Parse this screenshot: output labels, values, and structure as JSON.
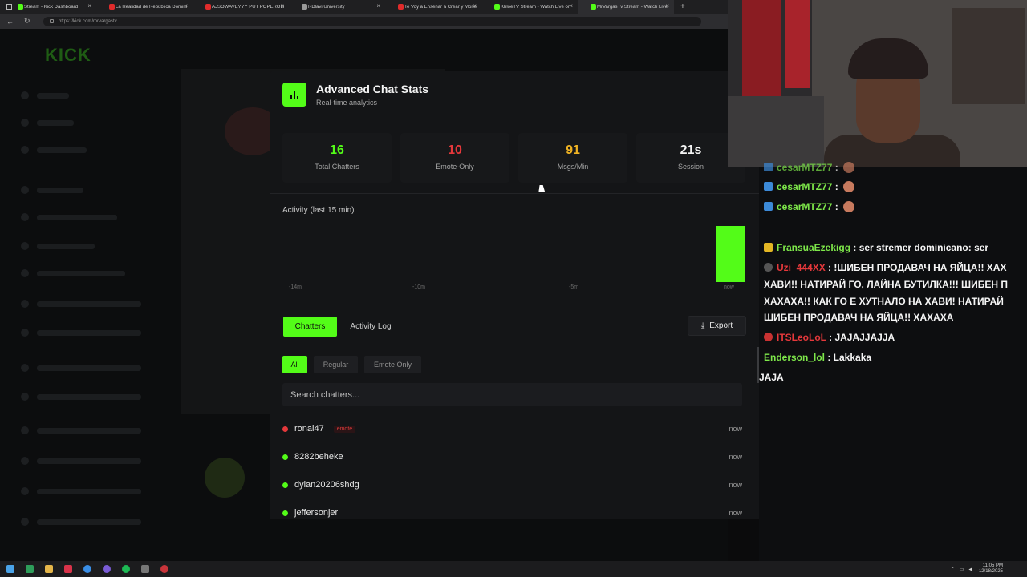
{
  "browser": {
    "tabs": [
      {
        "label": "Stream - Kick Dashboard",
        "color": "#53fc18"
      },
      {
        "label": "La Realidad de República Domini",
        "color": "#e02b2b"
      },
      {
        "label": "AJSOWAVEYYY PUT POPEROLIN",
        "color": "#e02b2b"
      },
      {
        "label": "RDlavi University",
        "color": "#9a9a9a"
      },
      {
        "label": "Te Voy a Enseñar a Crear y Monet",
        "color": "#e02b2b"
      },
      {
        "label": "KhloeTV Stream - Watch Live on",
        "color": "#53fc18"
      },
      {
        "label": "MrVargasTv Stream - Watch Live",
        "color": "#53fc18"
      }
    ],
    "url": "https://kick.com/mrvargastv",
    "new_tab": "+"
  },
  "background_page": {
    "logo": "KICK"
  },
  "modal": {
    "title": "Advanced Chat Stats",
    "subtitle": "Real-time analytics",
    "stats": [
      {
        "value": "16",
        "label": "Total Chatters",
        "color": "#53fc18"
      },
      {
        "value": "10",
        "label": "Emote-Only",
        "color": "#e5383b"
      },
      {
        "value": "91",
        "label": "Msgs/Min",
        "color": "#f0b323"
      },
      {
        "value": "21s",
        "label": "Session",
        "color": "#f4f4f4"
      }
    ],
    "activity_title": "Activity (last 15 min)",
    "activity_ticks": [
      "-14m",
      "-10m",
      "-5m",
      "now"
    ],
    "tabs": {
      "chatters": "Chatters",
      "activity_log": "Activity Log"
    },
    "export_label": "Export",
    "filters": {
      "all": "All",
      "regular": "Regular",
      "emote_only": "Emote Only"
    },
    "search_placeholder": "Search chatters...",
    "chatters": [
      {
        "name": "ronal47",
        "badge": "emote",
        "time": "now",
        "status_color": "#e5383b"
      },
      {
        "name": "8282beheke",
        "badge": "",
        "time": "now",
        "status_color": "#53fc18"
      },
      {
        "name": "dylan20206shdg",
        "badge": "",
        "time": "now",
        "status_color": "#53fc18"
      },
      {
        "name": "jeffersonjer",
        "badge": "",
        "time": "now",
        "status_color": "#53fc18"
      }
    ]
  },
  "chat_overlay": {
    "messages": [
      {
        "user": "cesarMTZ77",
        "text": " :",
        "user_color": "#7ee84a"
      },
      {
        "user": "cesarMTZ77",
        "text": " :",
        "user_color": "#7ee84a"
      },
      {
        "user": "cesarMTZ77",
        "text": " :",
        "user_color": "#7ee84a"
      },
      {
        "user": "FransuaEzekigg",
        "text": " : ser stremer dominicano: ser",
        "user_color": "#7ee84a"
      },
      {
        "user": "Uzi_444XX",
        "text": " : !ШИБЕН ПРОДАВАЧ НА ЯЙЦА!! ХАХ",
        "user_color": "#e5383b"
      },
      {
        "user": "",
        "text": "ХАВИ!! НАТИРАЙ ГО, ЛАЙНА БУТИЛКА!!! ШИБЕН П",
        "user_color": "#f5f5f5"
      },
      {
        "user": "",
        "text": "ХАХАХА!! КАК ГО Е ХУТНАЛО НА ХАВИ! НАТИРАЙ",
        "user_color": "#f5f5f5"
      },
      {
        "user": "",
        "text": "ШИБЕН ПРОДАВАЧ НА ЯЙЦА!! ХАХАХА",
        "user_color": "#f5f5f5"
      },
      {
        "user": "ITSLeoLoL",
        "text": " : JAJAJJAJJA",
        "user_color": "#e5383b"
      },
      {
        "user": "Enderson_lol",
        "text": " : Lakkaka",
        "user_color": "#7ee84a"
      },
      {
        "user": "",
        "text": "JAJA",
        "user_color": "#f5f5f5"
      }
    ]
  },
  "taskbar": {
    "time": "11:05 PM",
    "date": "12/18/2025"
  }
}
